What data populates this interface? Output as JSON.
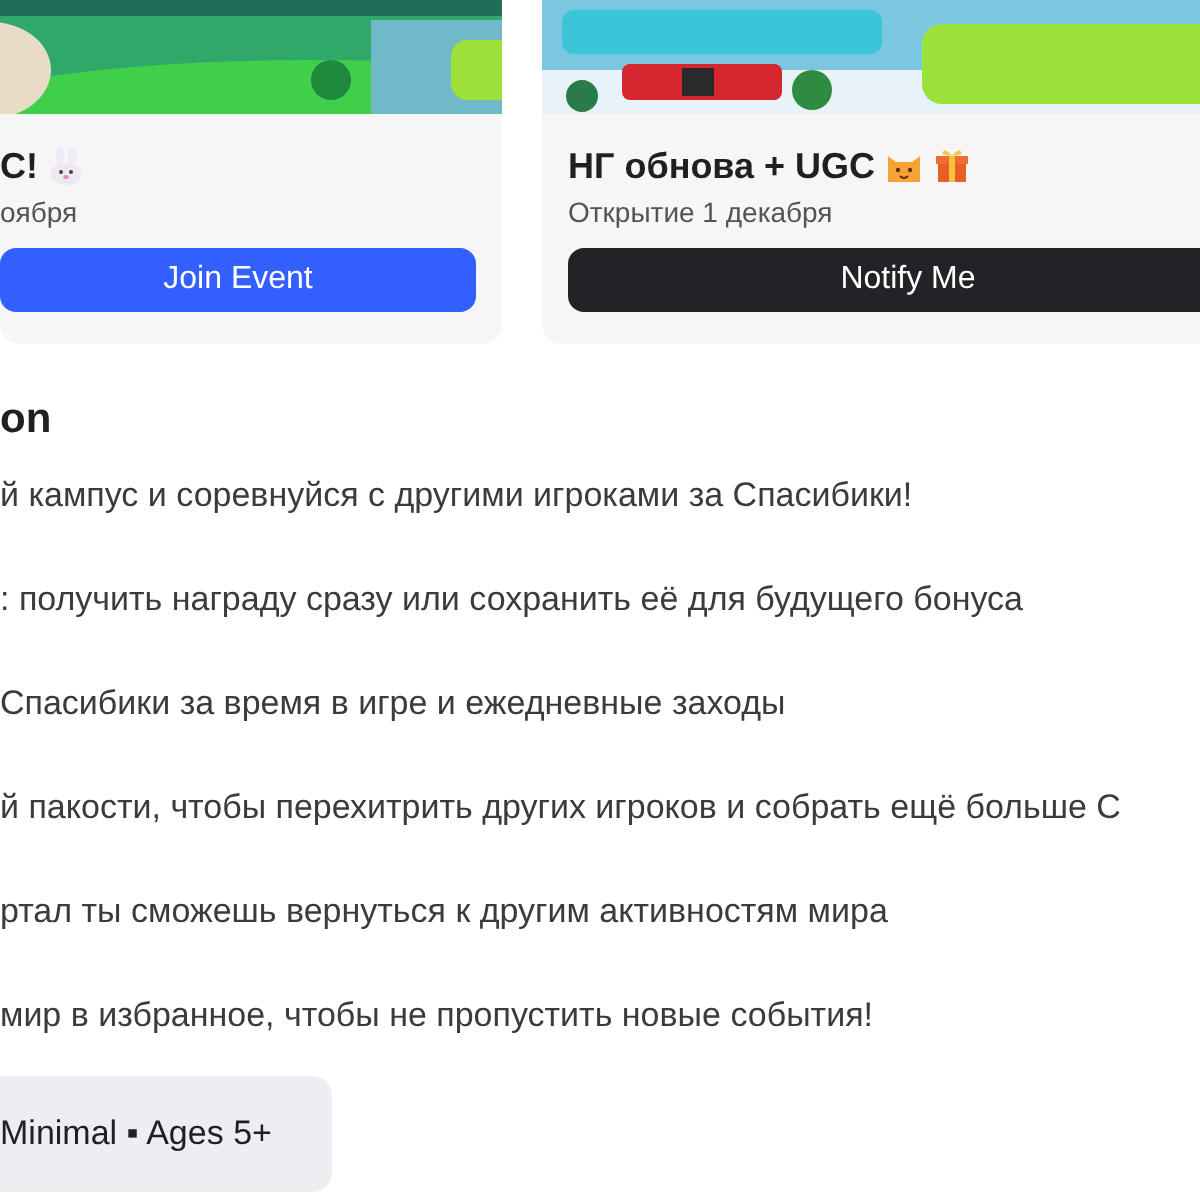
{
  "events": [
    {
      "banner": {
        "kind": "picture"
      },
      "title": "C!",
      "emojis": [
        {
          "kind": "rabbit"
        }
      ],
      "subtitle": "оября",
      "action": {
        "label": "Join Event",
        "kind": "primary"
      }
    },
    {
      "banner": {
        "kind": "picture"
      },
      "title": "НГ обнова + UGC",
      "emojis": [
        {
          "kind": "cat"
        },
        {
          "kind": "gift"
        }
      ],
      "subtitle": "Открытие 1 декабря",
      "action": {
        "label": "Notify Me",
        "kind": "secondary"
      }
    }
  ],
  "description": {
    "heading": "on",
    "paragraphs": [
      "й кампус и соревнуйся с другими игроками за Спасибики!",
      ": получить награду сразу или сохранить её для будущего бонуса",
      "Спасибики за время в игре и ежедневные заходы",
      "й пакости, чтобы перехитрить других игроков и собрать ещё больше С",
      "ртал ты сможешь вернуться к другим активностям мира",
      "мир в избранное, чтобы не пропустить новые события!"
    ]
  },
  "maturity": {
    "label": "Minimal ▪ Ages 5+"
  }
}
